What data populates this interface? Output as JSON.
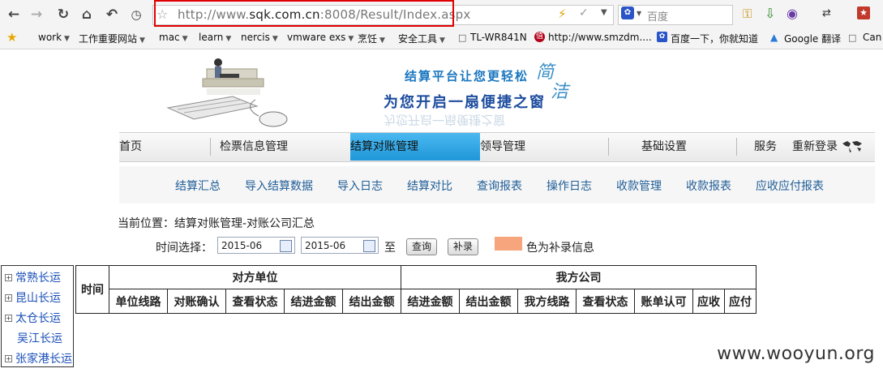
{
  "browser": {
    "url_prefix": "http://www.",
    "url_domain": "sqk.com.cn",
    "url_suffix": ":8008/Result/Index.aspx",
    "search_placeholder": "百度",
    "bookmarks": [
      {
        "label": "work",
        "menu": true
      },
      {
        "label": "工作重要网站",
        "menu": true
      },
      {
        "label": "mac",
        "menu": true
      },
      {
        "label": "learn",
        "menu": true
      },
      {
        "label": "nercis",
        "menu": true
      },
      {
        "label": "vmware exs",
        "menu": true
      },
      {
        "label": "烹饪",
        "menu": true
      },
      {
        "label": "安全工具",
        "menu": true
      },
      {
        "label": "TL-WR841N",
        "menu": false
      },
      {
        "label": "http://www.smzdm....",
        "menu": false
      },
      {
        "label": "百度一下，你就知道",
        "menu": false
      },
      {
        "label": "Google 翻译",
        "menu": false
      },
      {
        "label": "Can",
        "menu": false
      }
    ]
  },
  "banner": {
    "slogan1": "结算平台让您更轻松",
    "slogan2": "为您开启一扇便捷之窗",
    "brand1": "简",
    "brand2": "洁"
  },
  "menu": {
    "items": [
      "首页",
      "检票信息管理",
      "结算对账管理",
      "领导管理",
      "基础设置",
      "服务",
      "重新登录"
    ],
    "active": "结算对账管理"
  },
  "submenu": {
    "items": [
      "结算汇总",
      "导入结算数据",
      "导入日志",
      "结算对比",
      "查询报表",
      "操作日志",
      "收款管理",
      "收款报表",
      "应收应付报表"
    ]
  },
  "breadcrumb": "当前位置：结算对账管理-对账公司汇总",
  "filter": {
    "time_label": "时间选择：",
    "from": "2015-06",
    "to_label": "至",
    "to": "2015-06",
    "query_btn": "查询",
    "supplement_btn": "补录",
    "legend_text": "色为补录信息",
    "legend_color": "#f7a57c"
  },
  "tree": {
    "nodes": [
      {
        "label": "常熟长运",
        "expandable": true
      },
      {
        "label": "昆山长运",
        "expandable": true
      },
      {
        "label": "太仓长运",
        "expandable": true
      },
      {
        "label": "吴江长运",
        "expandable": false
      },
      {
        "label": "张家港长运",
        "expandable": true
      }
    ]
  },
  "grid": {
    "time_header": "时间",
    "group_left": "对方单位",
    "group_right": "我方公司",
    "left_cols": [
      "单位线路",
      "对账确认",
      "查看状态",
      "结进金额",
      "结出金额"
    ],
    "right_cols": [
      "结进金额",
      "结出金额",
      "我方线路",
      "查看状态",
      "账单认可",
      "应收",
      "应付"
    ]
  },
  "watermark": "www.wooyun.org"
}
